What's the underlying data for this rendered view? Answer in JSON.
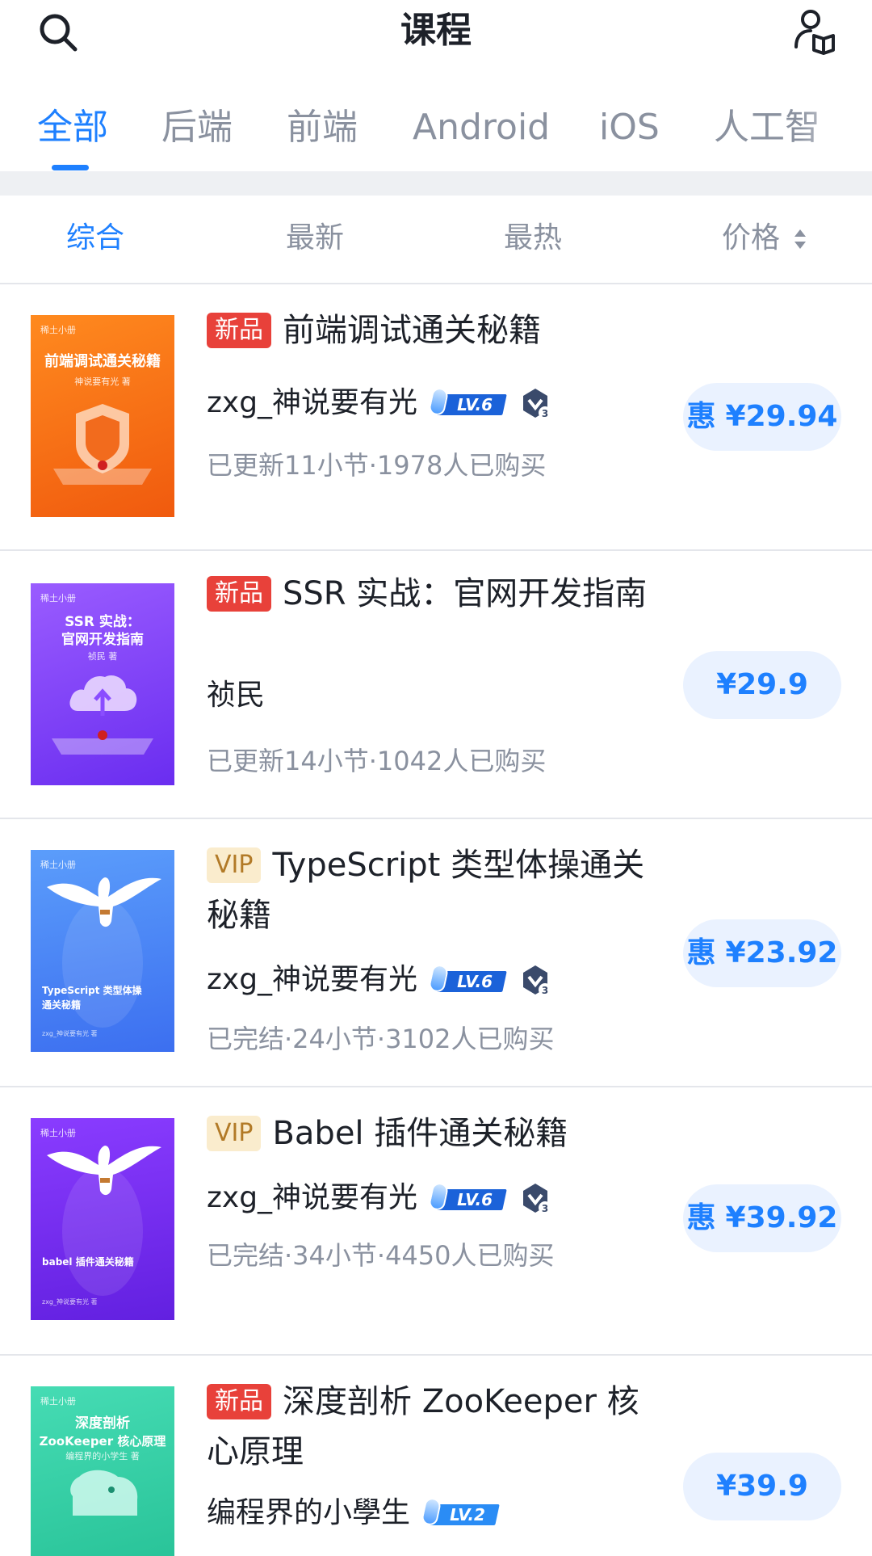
{
  "header": {
    "title": "课程",
    "search_icon": "search-icon",
    "profile_icon": "user-book-icon"
  },
  "category_tabs": [
    "全部",
    "后端",
    "前端",
    "Android",
    "iOS",
    "人工智"
  ],
  "active_category": "全部",
  "sort_tabs": [
    "综合",
    "最新",
    "最热",
    "价格"
  ],
  "active_sort": "综合",
  "colors": {
    "accent": "#1e80ff",
    "new_badge": "#e8413a",
    "vip_badge_bg": "#faeccd",
    "vip_badge_text": "#b27a27",
    "muted_text": "#8a919f",
    "price_bg": "#eaf2ff"
  },
  "courses": [
    {
      "badge": "新品",
      "title": "前端调试通关秘籍",
      "author": "zxg_神说要有光",
      "level": "LV.6",
      "medal": "3",
      "meta": "已更新11小节·1978人已购买",
      "discount_label": "惠",
      "price": "¥29.94",
      "cover": {
        "brand": "稀土小册",
        "title": "前端调试通关秘籍",
        "author": "神说要有光 著",
        "color": "#ff7a1a"
      }
    },
    {
      "badge": "新品",
      "title": "SSR 实战：官网开发指南",
      "author": "祯民",
      "meta": "已更新14小节·1042人已购买",
      "price": "¥29.9",
      "cover": {
        "brand": "稀土小册",
        "title_line1": "SSR 实战：",
        "title_line2": "官网开发指南",
        "author": "祯民 著",
        "color": "#8a4dff"
      }
    },
    {
      "badge": "VIP",
      "title": "TypeScript 类型体操通关秘籍",
      "author": "zxg_神说要有光",
      "level": "LV.6",
      "medal": "3",
      "meta": "已完结·24小节·3102人已购买",
      "discount_label": "惠",
      "price": "¥23.92",
      "cover": {
        "brand": "稀土小册",
        "title_line1": "TypeScript 类型体操",
        "title_line2": "通关秘籍",
        "author": "zxg_神说要有光 著",
        "color": "#4a8cf7"
      }
    },
    {
      "badge": "VIP",
      "title": "Babel 插件通关秘籍",
      "author": "zxg_神说要有光",
      "level": "LV.6",
      "medal": "3",
      "meta": "已完结·34小节·4450人已购买",
      "discount_label": "惠",
      "price": "¥39.92",
      "cover": {
        "brand": "稀土小册",
        "title": "babel 插件通关秘籍",
        "author": "zxg_神说要有光 著",
        "color": "#7a2cf0"
      }
    },
    {
      "badge": "新品",
      "title": "深度剖析 ZooKeeper 核心原理",
      "author": "编程界的小學生",
      "level": "LV.2",
      "price": "¥39.9",
      "cover": {
        "brand": "稀土小册",
        "title_line1": "深度剖析",
        "title_line2": "ZooKeeper 核心原理",
        "author": "编程界的小学生 著",
        "color": "#33d1a6"
      }
    }
  ]
}
